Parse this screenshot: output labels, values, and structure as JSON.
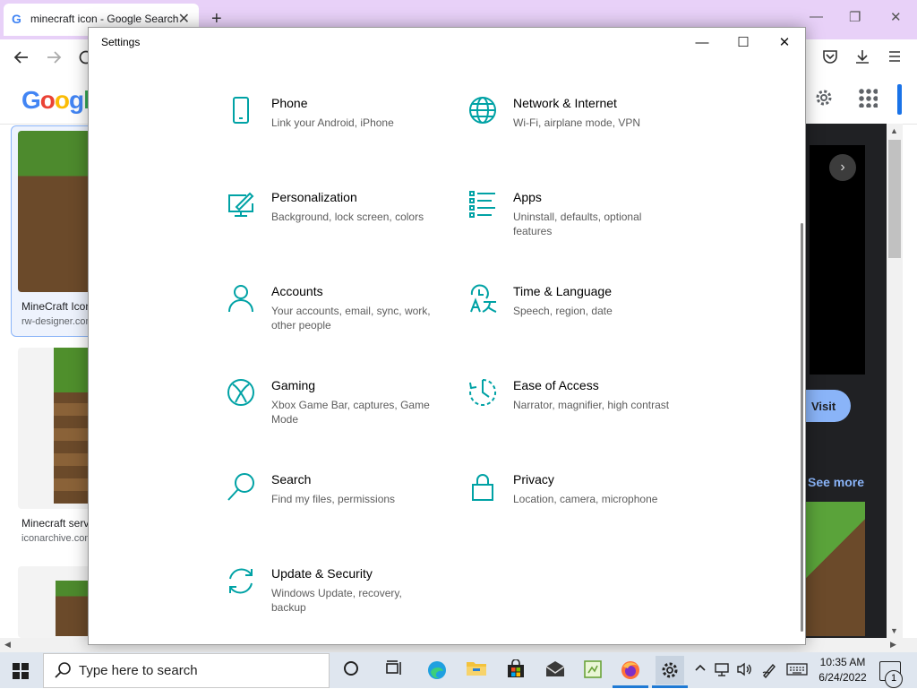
{
  "browser": {
    "tab_title": "minecraft icon - Google Search",
    "tab_favicon": "G",
    "tab_close": "✕",
    "new_tab": "+",
    "win_min": "—",
    "win_restore": "❐",
    "win_close": "✕"
  },
  "google": {
    "logo_letters": [
      "G",
      "o",
      "o",
      "g",
      "l"
    ]
  },
  "results": [
    {
      "title": "MineCraft Icon",
      "source": "rw-designer.com"
    },
    {
      "title": "Minecraft server",
      "source": "iconarchive.com"
    }
  ],
  "side_panel": {
    "next_arrow": "›",
    "visit_label": "Visit",
    "see_more_label": "See more"
  },
  "settings": {
    "window_title": "Settings",
    "min_label": "—",
    "max_label": "☐",
    "close_label": "✕",
    "accent_color": "#00a2a5",
    "tiles": [
      {
        "icon": "phone-icon",
        "title": "Phone",
        "desc": "Link your Android, iPhone"
      },
      {
        "icon": "globe-icon",
        "title": "Network & Internet",
        "desc": "Wi-Fi, airplane mode, VPN"
      },
      {
        "icon": "personalization-icon",
        "title": "Personalization",
        "desc": "Background, lock screen, colors"
      },
      {
        "icon": "apps-list-icon",
        "title": "Apps",
        "desc": "Uninstall, defaults, optional features"
      },
      {
        "icon": "person-icon",
        "title": "Accounts",
        "desc": "Your accounts, email, sync, work, other people"
      },
      {
        "icon": "time-language-icon",
        "title": "Time & Language",
        "desc": "Speech, region, date"
      },
      {
        "icon": "xbox-icon",
        "title": "Gaming",
        "desc": "Xbox Game Bar, captures, Game Mode"
      },
      {
        "icon": "ease-of-access-icon",
        "title": "Ease of Access",
        "desc": "Narrator, magnifier, high contrast"
      },
      {
        "icon": "search-icon",
        "title": "Search",
        "desc": "Find my files, permissions"
      },
      {
        "icon": "lock-icon",
        "title": "Privacy",
        "desc": "Location, camera, microphone"
      },
      {
        "icon": "sync-icon",
        "title": "Update & Security",
        "desc": "Windows Update, recovery, backup"
      }
    ]
  },
  "taskbar": {
    "search_placeholder": "Type here to search",
    "time": "10:35 AM",
    "date": "6/24/2022",
    "notification_count": "1"
  }
}
